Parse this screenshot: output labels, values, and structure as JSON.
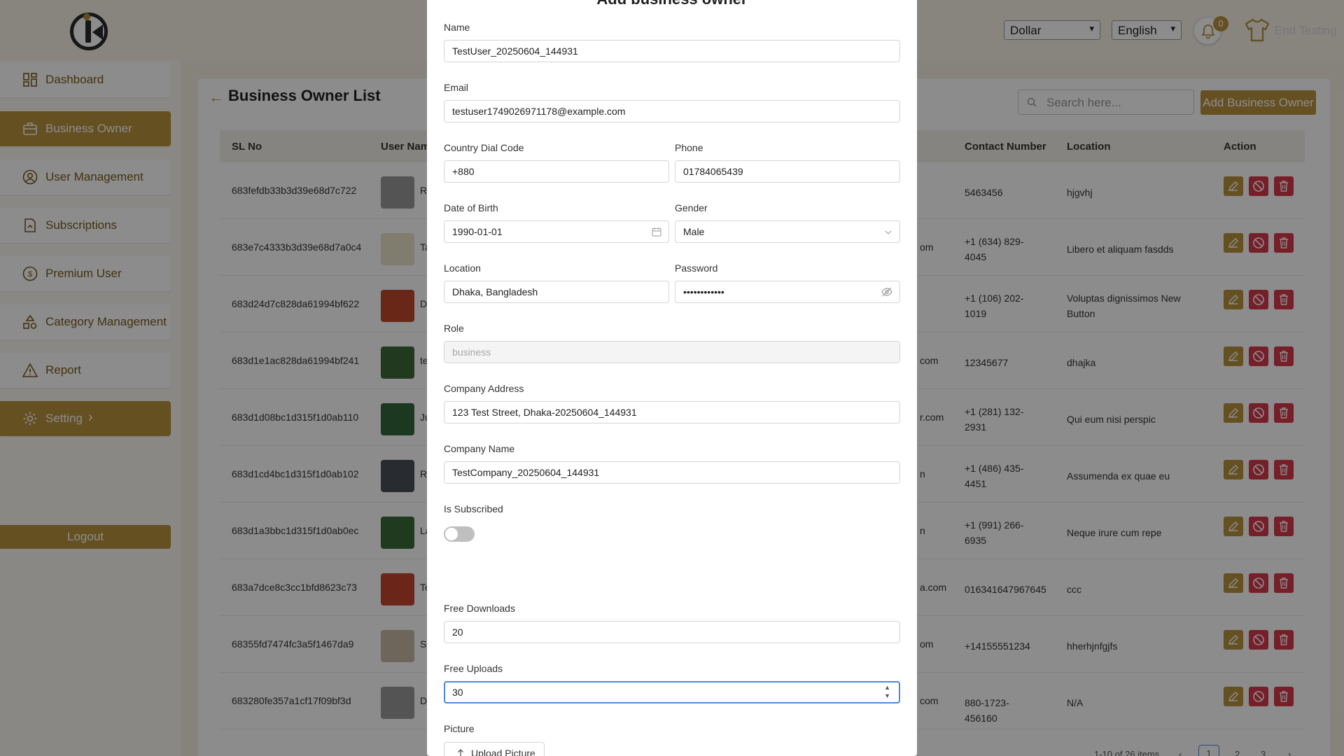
{
  "header": {
    "currency": "Dollar",
    "language": "English",
    "notification_count": "0",
    "end_testing": "End Testing"
  },
  "sidebar": {
    "items": [
      {
        "label": "Dashboard",
        "icon": "dashboard-icon",
        "active": false
      },
      {
        "label": "Business Owner",
        "icon": "briefcase-icon",
        "active": true
      },
      {
        "label": "User Management",
        "icon": "user-circle-icon",
        "active": false
      },
      {
        "label": "Subscriptions",
        "icon": "document-icon",
        "active": false
      },
      {
        "label": "Premium User",
        "icon": "dollar-circle-icon",
        "active": false
      },
      {
        "label": "Category Management",
        "icon": "shapes-icon",
        "active": false
      },
      {
        "label": "Report",
        "icon": "warning-icon",
        "active": false
      },
      {
        "label": "Setting",
        "icon": "gear-icon",
        "active": true
      }
    ],
    "setting_chevron": "›",
    "logout": "Logout"
  },
  "page": {
    "title": "Business Owner List",
    "search_placeholder": "Search here...",
    "add_button": "Add Business Owner"
  },
  "table": {
    "headers": {
      "sl_no": "SL No",
      "user_name": "User Name",
      "contact": "Contact Number",
      "location": "Location",
      "action": "Action"
    },
    "rows": [
      {
        "id": "683fefdb33b3d39e68d7c722",
        "name_frag": "R",
        "email_frag": "",
        "phone": "5463456",
        "location": "hjgvhj"
      },
      {
        "id": "683e7c4333b3d39e68d7a0c4",
        "name_frag": "Ta\nBi",
        "email_frag": "om",
        "phone": "+1 (634) 829-4045",
        "location": "Libero et aliquam fasdds"
      },
      {
        "id": "683d24d7c828da61994bf622",
        "name_frag": "D",
        "email_frag": "",
        "phone": "+1 (106) 202-1019",
        "location": "Voluptas dignissimos New Button"
      },
      {
        "id": "683d1e1ac828da61994bf241",
        "name_frag": "te",
        "email_frag": "com",
        "phone": "12345677",
        "location": "dhajka"
      },
      {
        "id": "683d1d08bc1d315f1d0ab110",
        "name_frag": "Ju",
        "email_frag": "r.com",
        "phone": "+1 (281) 132-2931",
        "location": "Qui eum nisi perspic"
      },
      {
        "id": "683d1cd4bc1d315f1d0ab102",
        "name_frag": "R",
        "email_frag": "n",
        "phone": "+1 (486) 435-4451",
        "location": "Assumenda ex quae eu"
      },
      {
        "id": "683d1a3bbc1d315f1d0ab0ec",
        "name_frag": "La",
        "email_frag": "n",
        "phone": "+1 (991) 266-6935",
        "location": "Neque irure cum repe"
      },
      {
        "id": "683a7dce8c3cc1bfd8623c73",
        "name_frag": "Te",
        "email_frag": "a.com",
        "phone": "016341647967645",
        "location": "ccc"
      },
      {
        "id": "68355fd7474fc3a5f1467da9",
        "name_frag": "S",
        "email_frag": "om",
        "phone": "+14155551234",
        "location": "hherhjnfgjfs"
      },
      {
        "id": "683280fe357a1cf17f09bf3d",
        "name_frag": "D",
        "email_frag": "com",
        "phone": "880-1723-456160",
        "location": "N/A"
      }
    ]
  },
  "pagination": {
    "summary": "1-10 of 26 items",
    "pages": [
      "1",
      "2",
      "3"
    ],
    "prev": "‹",
    "next": "›"
  },
  "modal": {
    "title": "Add business owner",
    "fields": {
      "name": {
        "label": "Name",
        "value": "TestUser_20250604_144931"
      },
      "email": {
        "label": "Email",
        "value": "testuser1749026971178@example.com"
      },
      "dial_code": {
        "label": "Country Dial Code",
        "value": "+880"
      },
      "phone": {
        "label": "Phone",
        "value": "01784065439"
      },
      "dob": {
        "label": "Date of Birth",
        "value": "1990-01-01"
      },
      "gender": {
        "label": "Gender",
        "value": "Male"
      },
      "location": {
        "label": "Location",
        "value": "Dhaka, Bangladesh"
      },
      "password": {
        "label": "Password",
        "value": "••••••••••••"
      },
      "role": {
        "label": "Role",
        "value": "business"
      },
      "company_address": {
        "label": "Company Address",
        "value": "123 Test Street, Dhaka-20250604_144931"
      },
      "company_name": {
        "label": "Company Name",
        "value": "TestCompany_20250604_144931"
      },
      "is_subscribed": {
        "label": "Is Subscribed",
        "on": false
      },
      "free_downloads": {
        "label": "Free Downloads",
        "value": "20"
      },
      "free_uploads": {
        "label": "Free Uploads",
        "value": "30"
      },
      "picture": {
        "label": "Picture",
        "button": "Upload Picture"
      }
    }
  },
  "colors": {
    "accent": "#b8933f",
    "danger": "#d83a4c",
    "focus": "#4c8ad9"
  }
}
